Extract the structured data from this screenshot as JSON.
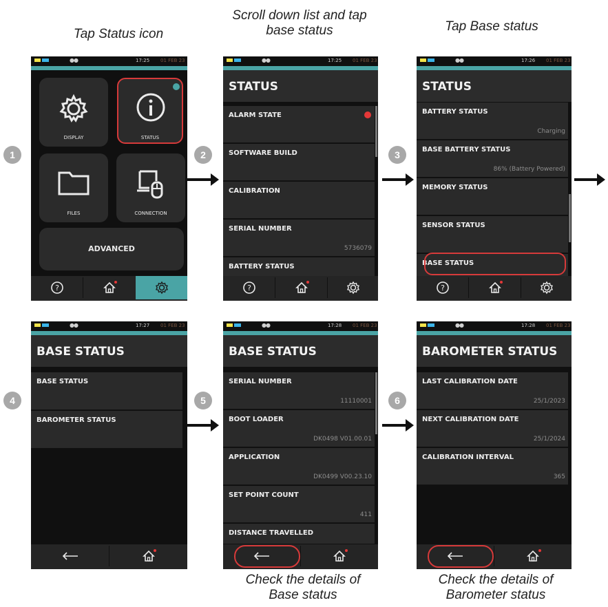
{
  "captions": {
    "step1": "Tap Status icon",
    "step2_line1": "Scroll down list and tap",
    "step2_line2": "base status",
    "step3": "Tap Base status",
    "step5_line1": "Check the details of",
    "step5_line2": "Base status",
    "step6_line1": "Check the details of",
    "step6_line2": "Barometer status"
  },
  "steps": [
    "1",
    "2",
    "3",
    "4",
    "5",
    "6"
  ],
  "screen1": {
    "time": "17:25",
    "date": "01 FEB 23",
    "tiles": {
      "display": "DISPLAY",
      "status": "STATUS",
      "files": "FILES",
      "connection": "CONNECTION",
      "advanced": "ADVANCED"
    },
    "icons": [
      "help-icon",
      "home-icon",
      "settings-icon"
    ]
  },
  "screen2": {
    "time": "17:25",
    "date": "01 FEB 23",
    "title": "STATUS",
    "rows": [
      {
        "label": "ALARM STATE",
        "value": ""
      },
      {
        "label": "SOFTWARE BUILD",
        "value": ""
      },
      {
        "label": "CALIBRATION",
        "value": ""
      },
      {
        "label": "SERIAL NUMBER",
        "value": "5736079"
      },
      {
        "label": "BATTERY STATUS",
        "value": ""
      }
    ]
  },
  "screen3": {
    "time": "17:26",
    "date": "01 FEB 23",
    "title": "STATUS",
    "rows": [
      {
        "label": "BATTERY STATUS",
        "value": "Charging"
      },
      {
        "label": "BASE BATTERY STATUS",
        "value": "86% (Battery Powered)"
      },
      {
        "label": "MEMORY STATUS",
        "value": ""
      },
      {
        "label": "SENSOR STATUS",
        "value": ""
      },
      {
        "label": "BASE STATUS",
        "value": ""
      }
    ]
  },
  "screen4": {
    "time": "17:27",
    "date": "01 FEB 23",
    "title": "BASE STATUS",
    "rows": [
      {
        "label": "BASE STATUS",
        "value": ""
      },
      {
        "label": "BAROMETER STATUS",
        "value": ""
      }
    ]
  },
  "screen5": {
    "time": "17:28",
    "date": "01 FEB 23",
    "title": "BASE STATUS",
    "rows": [
      {
        "label": "SERIAL NUMBER",
        "value": "11110001"
      },
      {
        "label": "BOOT LOADER",
        "value": "DK0498 V01.00.01"
      },
      {
        "label": "APPLICATION",
        "value": "DK0499 V00.23.10"
      },
      {
        "label": "SET POINT COUNT",
        "value": "411"
      },
      {
        "label": "DISTANCE TRAVELLED",
        "value": ""
      }
    ]
  },
  "screen6": {
    "time": "17:28",
    "date": "01 FEB 23",
    "title": "BAROMETER STATUS",
    "rows": [
      {
        "label": "LAST CALIBRATION DATE",
        "value": "25/1/2023"
      },
      {
        "label": "NEXT CALIBRATION DATE",
        "value": "25/1/2024"
      },
      {
        "label": "CALIBRATION INTERVAL",
        "value": "365"
      }
    ]
  },
  "colors": {
    "accent_teal": "#4aa4a5",
    "highlight_red": "#d73a3a",
    "alarm_red": "#e43838"
  }
}
